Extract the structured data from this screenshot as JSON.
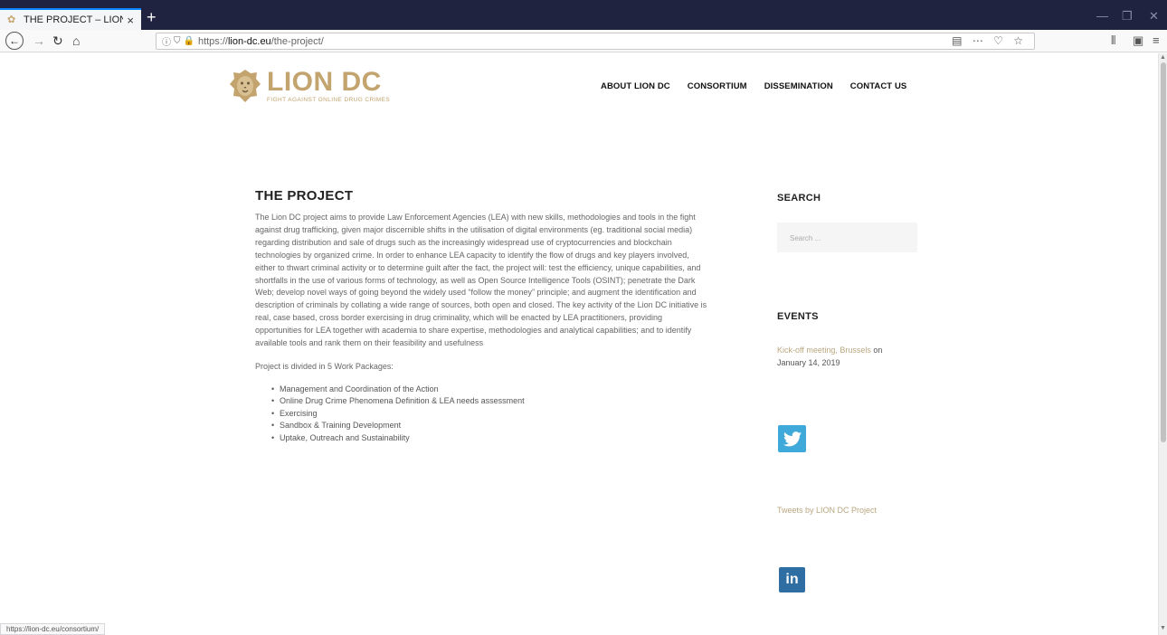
{
  "browser": {
    "tab_title": "THE PROJECT – LION DC",
    "tab_close": "×",
    "new_tab": "+",
    "url_host": "lion-dc.eu",
    "url_prefix": "https://",
    "url_path": "/the-project/",
    "status_url": "https://lion-dc.eu/consortium/"
  },
  "site": {
    "logo_main": "LION DC",
    "logo_sub": "FIGHT AGAINST ONLINE DRUG CRIMES",
    "nav": [
      "ABOUT LION DC",
      "CONSORTIUM",
      "DISSEMINATION",
      "CONTACT US"
    ],
    "accent_color": "#c3a46e"
  },
  "article": {
    "title": "THE PROJECT",
    "paragraph": "The Lion DC project aims to provide Law Enforcement Agencies (LEA) with new skills, methodologies and tools in the fight against drug trafficking, given major discernible shifts in the utilisation of digital environments (eg. traditional social media) regarding distribution and sale of drugs such as the increasingly widespread use of cryptocurrencies and blockchain technologies by organized crime. In order to enhance LEA capacity to identify the flow of drugs and key players involved, either to thwart criminal activity or to determine guilt after the fact, the project will: test the efficiency, unique capabilities, and shortfalls in the use of various forms of technology, as well as Open Source Intelligence Tools (OSINT); penetrate the Dark Web; develop novel ways of going beyond the widely used “follow the money” principle; and augment the identification and description of criminals by collating a wide range of sources, both open and closed. The key activity of the Lion DC initiative is real, case based, cross border exercising in drug criminality, which will be enacted by LEA practitioners, providing opportunities for LEA together with academia to share expertise, methodologies and analytical capabilities; and to identify available tools and rank them on their feasibility and usefulness",
    "wp_intro": "Project is divided in 5 Work Packages:",
    "work_packages": [
      "Management and Coordination of the Action",
      "Online Drug Crime Phenomena Definition & LEA needs assessment",
      "Exercising",
      "Sandbox & Training Development",
      "Uptake, Outreach and Sustainability"
    ]
  },
  "sidebar": {
    "search_heading": "SEARCH",
    "search_placeholder": "Search ...",
    "events_heading": "EVENTS",
    "event_link": "Kick-off meeting, Brussels",
    "event_on": "on",
    "event_date": "January 14, 2019",
    "tweets_link": "Tweets by LION DC Project",
    "linkedin_text": "in"
  }
}
